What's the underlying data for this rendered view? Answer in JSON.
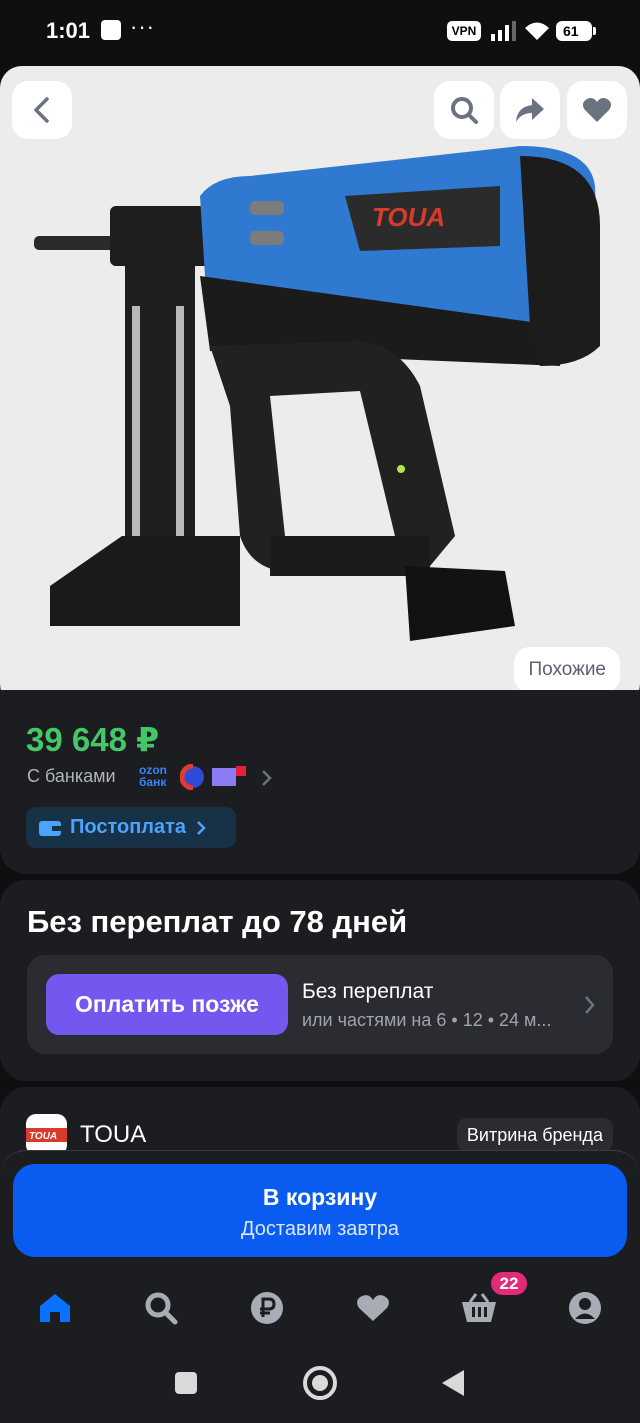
{
  "status_bar": {
    "time": "1:01",
    "dots": "···",
    "vpn": "VPN",
    "battery": "61"
  },
  "product": {
    "brand_logo_text": "TOUA",
    "similar_label": "Похожие",
    "price": "39 648 ₽",
    "banks_label": "С банками",
    "ozon_bank": "ozon банк",
    "postpay_label": "Постоплата"
  },
  "installments": {
    "title": "Без переплат до 78 дней",
    "pay_later": "Оплатить позже",
    "line1": "Без переплат",
    "line2": "или частями на 6 • 12 • 24 м..."
  },
  "brand": {
    "name": "TOUA",
    "storefront": "Витрина бренда"
  },
  "cart": {
    "label": "В корзину",
    "sub": "Доставим завтра"
  },
  "tabs": {
    "cart_badge": "22"
  },
  "colors": {
    "price": "#44c766",
    "accent": "#0a5cf0",
    "pay_later": "#7457ef",
    "badge": "#e22b78"
  }
}
